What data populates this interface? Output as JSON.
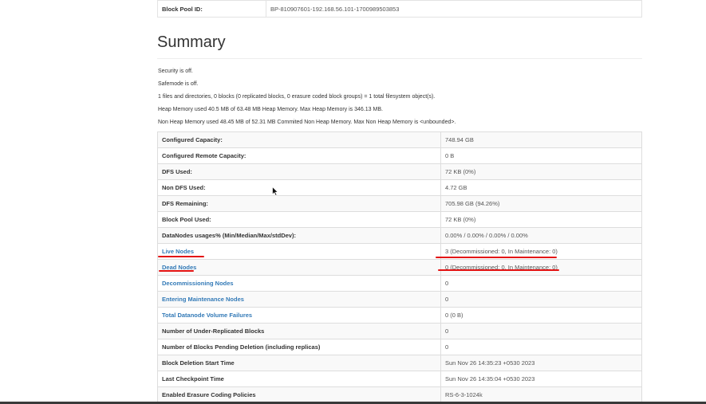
{
  "block_pool": {
    "label": "Block Pool ID:",
    "value": "BP-810907601-192.168.56.101-1700989503853"
  },
  "summary": {
    "title": "Summary",
    "notes": [
      "Security is off.",
      "Safemode is off.",
      "1 files and directories, 0 blocks (0 replicated blocks, 0 erasure coded block groups) = 1 total filesystem object(s).",
      "Heap Memory used 40.5 MB of 63.48 MB Heap Memory. Max Heap Memory is 346.13 MB.",
      "Non Heap Memory used 48.45 MB of 52.31 MB Commited Non Heap Memory. Max Non Heap Memory is <unbounded>."
    ],
    "rows": [
      {
        "label": "Configured Capacity:",
        "value": "748.94 GB"
      },
      {
        "label": "Configured Remote Capacity:",
        "value": "0 B"
      },
      {
        "label": "DFS Used:",
        "value": "72 KB (0%)"
      },
      {
        "label": "Non DFS Used:",
        "value": "4.72 GB"
      },
      {
        "label": "DFS Remaining:",
        "value": "705.98 GB (94.26%)"
      },
      {
        "label": "Block Pool Used:",
        "value": "72 KB (0%)"
      },
      {
        "label": "DataNodes usages% (Min/Median/Max/stdDev):",
        "value": "0.00% / 0.00% / 0.00% / 0.00%"
      },
      {
        "label": "Live Nodes",
        "value": "3 (Decommissioned: 0, In Maintenance: 0)"
      },
      {
        "label": "Dead Nodes",
        "value": "0 (Decommissioned: 0, In Maintenance: 0)"
      },
      {
        "label": "Decommissioning Nodes",
        "value": "0"
      },
      {
        "label": "Entering Maintenance Nodes",
        "value": "0"
      },
      {
        "label": "Total Datanode Volume Failures",
        "value": "0 (0 B)"
      },
      {
        "label": "Number of Under-Replicated Blocks",
        "value": "0"
      },
      {
        "label": "Number of Blocks Pending Deletion (including replicas)",
        "value": "0"
      },
      {
        "label": "Block Deletion Start Time",
        "value": "Sun Nov 26 14:35:23 +0530 2023"
      },
      {
        "label": "Last Checkpoint Time",
        "value": "Sun Nov 26 14:35:04 +0530 2023"
      },
      {
        "label": "Enabled Erasure Coding Policies",
        "value": "RS-6-3-1024k"
      }
    ]
  },
  "colors": {
    "link": "#337ab7",
    "annotation": "#e31212",
    "stripe": "#f9f9f9",
    "border": "#dddddd"
  }
}
